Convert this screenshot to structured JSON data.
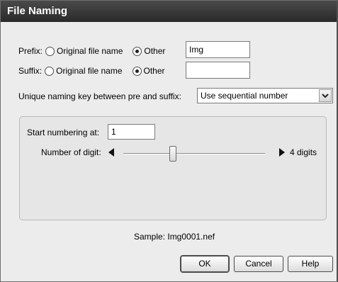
{
  "dialog": {
    "title": "File Naming"
  },
  "prefix": {
    "label": "Prefix:",
    "option_original": "Original file name",
    "option_other": "Other",
    "selected": "other",
    "value": "Img"
  },
  "suffix": {
    "label": "Suffix:",
    "option_original": "Original file name",
    "option_other": "Other",
    "selected": "other",
    "value": ""
  },
  "naming_key": {
    "label": "Unique naming key between pre and suffix:",
    "selected": "Use sequential number"
  },
  "numbering": {
    "start_label": "Start numbering at:",
    "start_value": "1",
    "digits_label": "Number of digit:",
    "digits_value_text": "4 digits",
    "digits_level": 4
  },
  "sample": {
    "text": "Sample: Img0001.nef"
  },
  "buttons": {
    "ok": "OK",
    "cancel": "Cancel",
    "help": "Help"
  }
}
